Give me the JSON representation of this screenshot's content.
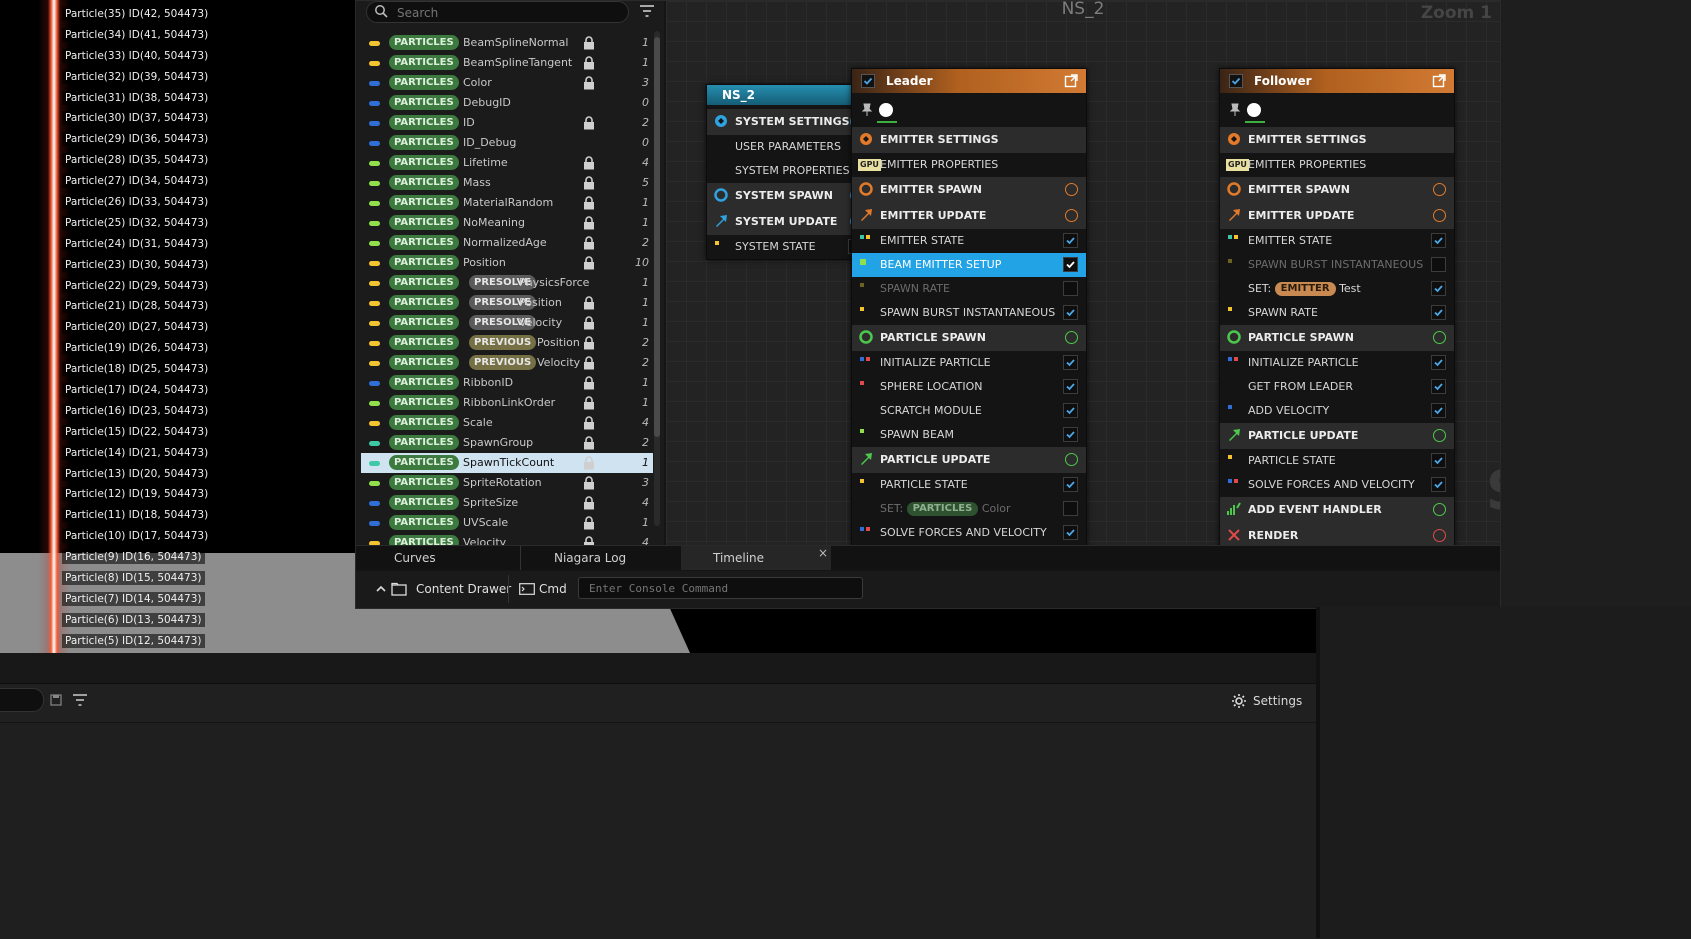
{
  "viewport": {
    "particles": [
      "Particle(35) ID(42, 504473)",
      "Particle(34) ID(41, 504473)",
      "Particle(33) ID(40, 504473)",
      "Particle(32) ID(39, 504473)",
      "Particle(31) ID(38, 504473)",
      "Particle(30) ID(37, 504473)",
      "Particle(29) ID(36, 504473)",
      "Particle(28) ID(35, 504473)",
      "Particle(27) ID(34, 504473)",
      "Particle(26) ID(33, 504473)",
      "Particle(25) ID(32, 504473)",
      "Particle(24) ID(31, 504473)",
      "Particle(23) ID(30, 504473)",
      "Particle(22) ID(29, 504473)",
      "Particle(21) ID(28, 504473)",
      "Particle(20) ID(27, 504473)",
      "Particle(19) ID(26, 504473)",
      "Particle(18) ID(25, 504473)",
      "Particle(17) ID(24, 504473)",
      "Particle(16) ID(23, 504473)",
      "Particle(15) ID(22, 504473)",
      "Particle(14) ID(21, 504473)",
      "Particle(13) ID(20, 504473)",
      "Particle(12) ID(19, 504473)",
      "Particle(11) ID(18, 504473)",
      "Particle(10) ID(17, 504473)",
      "Particle(9) ID(16, 504473)",
      "Particle(8) ID(15, 504473)",
      "Particle(7) ID(14, 504473)",
      "Particle(6) ID(13, 504473)",
      "Particle(5) ID(12, 504473)"
    ]
  },
  "params": {
    "search_placeholder": "Search",
    "rows": [
      {
        "dot": "#f4c430",
        "badge": "PARTICLES",
        "name": "BeamSplineNormal",
        "locked": true,
        "count": "1"
      },
      {
        "dot": "#f4c430",
        "badge": "PARTICLES",
        "name": "BeamSplineTangent",
        "locked": true,
        "count": "1"
      },
      {
        "dot": "#2f6fd6",
        "badge": "PARTICLES",
        "name": "Color",
        "locked": true,
        "count": "3"
      },
      {
        "dot": "#2f6fd6",
        "badge": "PARTICLES",
        "name": "DebugID",
        "locked": false,
        "count": "0"
      },
      {
        "dot": "#2f6fd6",
        "badge": "PARTICLES",
        "name": "ID",
        "locked": true,
        "count": "2"
      },
      {
        "dot": "#2f6fd6",
        "badge": "PARTICLES",
        "name": "ID_Debug",
        "locked": false,
        "count": "0"
      },
      {
        "dot": "#8fe04a",
        "badge": "PARTICLES",
        "name": "Lifetime",
        "locked": true,
        "count": "4"
      },
      {
        "dot": "#8fe04a",
        "badge": "PARTICLES",
        "name": "Mass",
        "locked": true,
        "count": "5"
      },
      {
        "dot": "#8fe04a",
        "badge": "PARTICLES",
        "name": "MaterialRandom",
        "locked": true,
        "count": "1"
      },
      {
        "dot": "#8fe04a",
        "badge": "PARTICLES",
        "name": "NoMeaning",
        "locked": true,
        "count": "1"
      },
      {
        "dot": "#8fe04a",
        "badge": "PARTICLES",
        "name": "NormalizedAge",
        "locked": true,
        "count": "2"
      },
      {
        "dot": "#f4c430",
        "badge": "PARTICLES",
        "name": "Position",
        "locked": true,
        "count": "10"
      },
      {
        "dot": "#f4c430",
        "badge": "PARTICLES",
        "badge2": "PRESOLVE",
        "name": "PhysicsForce",
        "locked": false,
        "count": "1"
      },
      {
        "dot": "#f4c430",
        "badge": "PARTICLES",
        "badge2": "PRESOLVE",
        "name": "Position",
        "locked": true,
        "count": "1"
      },
      {
        "dot": "#f4c430",
        "badge": "PARTICLES",
        "badge2": "PRESOLVE",
        "name": "Velocity",
        "locked": true,
        "count": "1"
      },
      {
        "dot": "#f4c430",
        "badge": "PARTICLES",
        "badge2": "PREVIOUS",
        "name": "Position",
        "locked": true,
        "count": "2"
      },
      {
        "dot": "#f4c430",
        "badge": "PARTICLES",
        "badge2": "PREVIOUS",
        "name": "Velocity",
        "locked": true,
        "count": "2"
      },
      {
        "dot": "#2f6fd6",
        "badge": "PARTICLES",
        "name": "RibbonID",
        "locked": true,
        "count": "1"
      },
      {
        "dot": "#8fe04a",
        "badge": "PARTICLES",
        "name": "RibbonLinkOrder",
        "locked": true,
        "count": "1"
      },
      {
        "dot": "#f4c430",
        "badge": "PARTICLES",
        "name": "Scale",
        "locked": true,
        "count": "4"
      },
      {
        "dot": "#3ec9a6",
        "badge": "PARTICLES",
        "name": "SpawnGroup",
        "locked": true,
        "count": "2"
      },
      {
        "dot": "#3ec9a6",
        "badge": "PARTICLES",
        "name": "SpawnTickCount",
        "locked": true,
        "count": "1",
        "selected": true
      },
      {
        "dot": "#8fe04a",
        "badge": "PARTICLES",
        "name": "SpriteRotation",
        "locked": true,
        "count": "3"
      },
      {
        "dot": "#2f6fd6",
        "badge": "PARTICLES",
        "name": "SpriteSize",
        "locked": true,
        "count": "4"
      },
      {
        "dot": "#2f6fd6",
        "badge": "PARTICLES",
        "name": "UVScale",
        "locked": true,
        "count": "1"
      },
      {
        "dot": "#f4c430",
        "badge": "PARTICLES",
        "name": "Velocity",
        "locked": true,
        "count": "4"
      }
    ]
  },
  "graph": {
    "title": "NS_2",
    "zoom": "Zoom 1",
    "watermark": "SYSTEM",
    "system_node": {
      "title": "NS_2",
      "system_settings": "SYSTEM SETTINGS",
      "user_parameters": "USER PARAMETERS",
      "system_properties": "SYSTEM PROPERTIES",
      "system_spawn": "SYSTEM SPAWN",
      "system_update": "SYSTEM UPDATE",
      "system_state": "SYSTEM STATE"
    },
    "leader": {
      "title": "Leader",
      "emitter_settings": "EMITTER SETTINGS",
      "emitter_properties": "EMITTER PROPERTIES",
      "gpu_tag": "GPU",
      "emitter_spawn": "EMITTER SPAWN",
      "emitter_update": "EMITTER UPDATE",
      "emitter_state": "EMITTER STATE",
      "beam_emitter_setup": "BEAM EMITTER SETUP",
      "spawn_rate": "SPAWN RATE",
      "spawn_burst": "SPAWN BURST INSTANTANEOUS",
      "particle_spawn": "PARTICLE SPAWN",
      "initialize_particle": "INITIALIZE PARTICLE",
      "sphere_location": "SPHERE LOCATION",
      "scratch_module": "SCRATCH MODULE",
      "spawn_beam": "SPAWN BEAM",
      "particle_update": "PARTICLE UPDATE",
      "particle_state": "PARTICLE STATE",
      "set_prefix": "SET:",
      "set_badge": "PARTICLES",
      "set_value": "Color",
      "solve_forces": "SOLVE FORCES AND VELOCITY"
    },
    "follower": {
      "title": "Follower",
      "emitter_settings": "EMITTER SETTINGS",
      "emitter_properties": "EMITTER PROPERTIES",
      "gpu_tag": "GPU",
      "emitter_spawn": "EMITTER SPAWN",
      "emitter_update": "EMITTER UPDATE",
      "emitter_state": "EMITTER STATE",
      "spawn_burst": "SPAWN BURST INSTANTANEOUS",
      "set_prefix": "SET:",
      "set_badge": "EMITTER",
      "set_value": "Test",
      "spawn_rate": "SPAWN RATE",
      "particle_spawn": "PARTICLE SPAWN",
      "initialize_particle": "INITIALIZE PARTICLE",
      "get_from_leader": "GET FROM LEADER",
      "add_velocity": "ADD VELOCITY",
      "particle_update": "PARTICLE UPDATE",
      "particle_state": "PARTICLE STATE",
      "solve_forces": "SOLVE FORCES AND VELOCITY",
      "add_event_handler": "ADD EVENT HANDLER",
      "render": "RENDER"
    }
  },
  "tabs": {
    "curves": "Curves",
    "niagara_log": "Niagara Log",
    "timeline": "Timeline",
    "close": "×"
  },
  "statusbar": {
    "content_drawer": "Content Drawer",
    "cmd": "Cmd",
    "console_placeholder": "Enter Console Command"
  },
  "details": {
    "settings": "Settings"
  },
  "colors": {
    "selection": "#22a3e6",
    "leader_header": "#c76a25",
    "system_header": "#1f7f9e",
    "particles_badge": "#3d7a3f",
    "emitter_badge": "#c98a52"
  }
}
